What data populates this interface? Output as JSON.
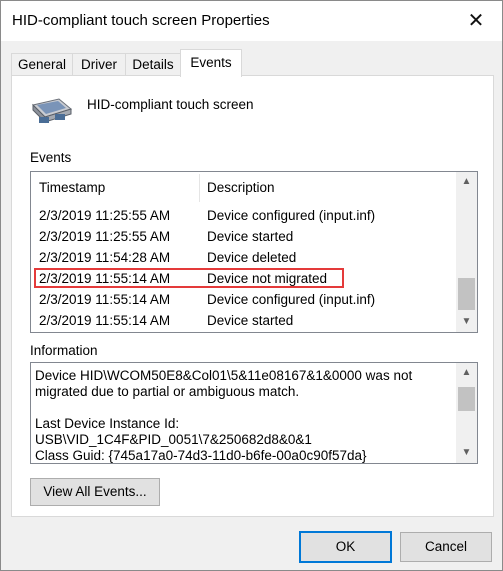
{
  "window": {
    "title": "HID-compliant touch screen Properties"
  },
  "tabs": [
    {
      "label": "General"
    },
    {
      "label": "Driver"
    },
    {
      "label": "Details"
    },
    {
      "label": "Events"
    }
  ],
  "device": {
    "name": "HID-compliant touch screen",
    "icon": "touch-screen-device-icon"
  },
  "events": {
    "label": "Events",
    "columns": [
      "Timestamp",
      "Description"
    ],
    "rows": [
      {
        "timestamp": "2/3/2019 11:25:55 AM",
        "description": "Device configured (input.inf)"
      },
      {
        "timestamp": "2/3/2019 11:25:55 AM",
        "description": "Device started"
      },
      {
        "timestamp": "2/3/2019 11:54:28 AM",
        "description": "Device deleted"
      },
      {
        "timestamp": "2/3/2019 11:55:14 AM",
        "description": "Device not migrated"
      },
      {
        "timestamp": "2/3/2019 11:55:14 AM",
        "description": "Device configured (input.inf)"
      },
      {
        "timestamp": "2/3/2019 11:55:14 AM",
        "description": "Device started"
      }
    ],
    "highlighted_row": 3,
    "highlight_color": "#e43a3a"
  },
  "information": {
    "label": "Information",
    "text": "Device HID\\WCOM50E8&Col01\\5&11e08167&1&0000 was not migrated due to partial or ambiguous match.\n\nLast Device Instance Id: USB\\VID_1C4F&PID_0051\\7&250682d8&0&1\nClass Guid: {745a17a0-74d3-11d0-b6fe-00a0c90f57da}"
  },
  "buttons": {
    "view_all": "View All Events...",
    "ok": "OK",
    "cancel": "Cancel"
  },
  "colors": {
    "accent": "#0078d7"
  }
}
